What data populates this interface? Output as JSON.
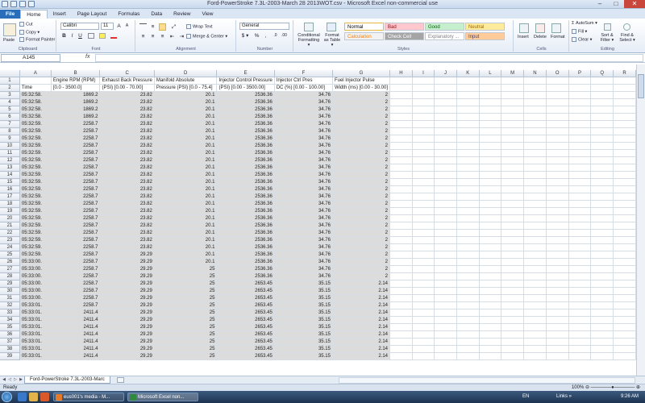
{
  "window": {
    "title": "Ford-PowerStroke 7.3L-2003-March 28 2013WOT.csv - Microsoft Excel non-commercial use",
    "min": "–",
    "max": "□",
    "close": "✕"
  },
  "ribbon_tabs": [
    "File",
    "Home",
    "Insert",
    "Page Layout",
    "Formulas",
    "Data",
    "Review",
    "View"
  ],
  "clipboard": {
    "paste": "Paste",
    "cut": "Cut",
    "copy": "Copy ▾",
    "format_painter": "Format Painter",
    "label": "Clipboard"
  },
  "font": {
    "name": "Calibri",
    "size": "11",
    "grow": "A",
    "shrink": "A",
    "bold": "B",
    "italic": "I",
    "underline": "U",
    "label": "Font"
  },
  "alignment": {
    "wrap": "Wrap Text",
    "merge": "Merge & Center ▾",
    "label": "Alignment"
  },
  "number": {
    "format": "General",
    "currency": "$ ▾",
    "percent": "%",
    "comma": ",",
    "label": "Number"
  },
  "styles": {
    "conditional": "Conditional Formatting ▾",
    "format_table": "Format as Table ▾",
    "cells": [
      {
        "label": "Normal",
        "bg": "#ffffff",
        "fg": "#000000"
      },
      {
        "label": "Bad",
        "bg": "#ffc7ce",
        "fg": "#9c0006"
      },
      {
        "label": "Good",
        "bg": "#c6efce",
        "fg": "#006100"
      },
      {
        "label": "Neutral",
        "bg": "#ffeb9c",
        "fg": "#9c6500"
      },
      {
        "label": "Calculation",
        "bg": "#f2f2f2",
        "fg": "#fa7d00"
      },
      {
        "label": "Check Cell",
        "bg": "#a5a5a5",
        "fg": "#ffffff"
      },
      {
        "label": "Explanatory ...",
        "bg": "#ffffff",
        "fg": "#7f7f7f"
      },
      {
        "label": "Input",
        "bg": "#ffcc99",
        "fg": "#3f3f76"
      }
    ],
    "label": "Styles"
  },
  "cells_group": {
    "insert": "Insert",
    "delete": "Delete",
    "format": "Format",
    "label": "Cells"
  },
  "editing": {
    "autosum": "AutoSum ▾",
    "fill": "Fill ▾",
    "clear": "Clear ▾",
    "sort": "Sort & Filter ▾",
    "find": "Find & Select ▾",
    "label": "Editing"
  },
  "formula_bar": {
    "name_box": "A145",
    "fx": "fx",
    "formula": ""
  },
  "columns": [
    "A",
    "B",
    "C",
    "D",
    "E",
    "F",
    "G",
    "H",
    "I",
    "J",
    "K",
    "L",
    "M",
    "N",
    "O",
    "P",
    "Q",
    "R"
  ],
  "header_row1": [
    "",
    "Engine RPM (RPM)",
    "Exhaust Back Pressure",
    "Manifold Absolute",
    "Injector Control Pressure",
    "Injector Ctrl Pres",
    "Fuel Injector Pulse"
  ],
  "header_row2": [
    "Time",
    "[0.0 - 3500.0]",
    "(PSI) [0.00 - 70.00]",
    "Pressure (PSI) [0.0 - 75.4]",
    "(PSI) [0.00 - 3500.00]",
    "DC (%) [0.00 - 100.00]",
    "Width (ms) [0.00 - 30.00]"
  ],
  "rows": [
    [
      "05:32:58.",
      "1869.2",
      "23.82",
      "20.1",
      "2536.36",
      "34.76",
      "2"
    ],
    [
      "05:32:58.",
      "1869.2",
      "23.82",
      "20.1",
      "2536.36",
      "34.76",
      "2"
    ],
    [
      "05:32:58.",
      "1869.2",
      "23.82",
      "20.1",
      "2536.36",
      "34.76",
      "2"
    ],
    [
      "05:32:58.",
      "1869.2",
      "23.82",
      "20.1",
      "2536.36",
      "34.76",
      "2"
    ],
    [
      "05:32:59.",
      "2258.7",
      "23.82",
      "20.1",
      "2536.36",
      "34.76",
      "2"
    ],
    [
      "05:32:59.",
      "2258.7",
      "23.82",
      "20.1",
      "2536.36",
      "34.76",
      "2"
    ],
    [
      "05:32:59.",
      "2258.7",
      "23.82",
      "20.1",
      "2536.36",
      "34.76",
      "2"
    ],
    [
      "05:32:59.",
      "2258.7",
      "23.82",
      "20.1",
      "2536.36",
      "34.76",
      "2"
    ],
    [
      "05:32:59.",
      "2258.7",
      "23.82",
      "20.1",
      "2536.36",
      "34.76",
      "2"
    ],
    [
      "05:32:59.",
      "2258.7",
      "23.82",
      "20.1",
      "2536.36",
      "34.76",
      "2"
    ],
    [
      "05:32:59.",
      "2258.7",
      "23.82",
      "20.1",
      "2536.36",
      "34.76",
      "2"
    ],
    [
      "05:32:59.",
      "2258.7",
      "23.82",
      "20.1",
      "2536.36",
      "34.76",
      "2"
    ],
    [
      "05:32:59.",
      "2258.7",
      "23.82",
      "20.1",
      "2536.36",
      "34.76",
      "2"
    ],
    [
      "05:32:59.",
      "2258.7",
      "23.82",
      "20.1",
      "2536.36",
      "34.76",
      "2"
    ],
    [
      "05:32:59.",
      "2258.7",
      "23.82",
      "20.1",
      "2536.36",
      "34.76",
      "2"
    ],
    [
      "05:32:59.",
      "2258.7",
      "23.82",
      "20.1",
      "2536.36",
      "34.76",
      "2"
    ],
    [
      "05:32:59.",
      "2258.7",
      "23.82",
      "20.1",
      "2536.36",
      "34.76",
      "2"
    ],
    [
      "05:32:59.",
      "2258.7",
      "23.82",
      "20.1",
      "2536.36",
      "34.76",
      "2"
    ],
    [
      "05:32:59.",
      "2258.7",
      "23.82",
      "20.1",
      "2536.36",
      "34.76",
      "2"
    ],
    [
      "05:32:59.",
      "2258.7",
      "23.82",
      "20.1",
      "2536.36",
      "34.76",
      "2"
    ],
    [
      "05:32:59.",
      "2258.7",
      "23.82",
      "20.1",
      "2536.36",
      "34.76",
      "2"
    ],
    [
      "05:32:59.",
      "2258.7",
      "23.82",
      "20.1",
      "2536.36",
      "34.76",
      "2"
    ],
    [
      "05:32:59.",
      "2258.7",
      "29.29",
      "20.1",
      "2536.36",
      "34.76",
      "2"
    ],
    [
      "05:33:00.",
      "2258.7",
      "29.29",
      "20.1",
      "2536.36",
      "34.76",
      "2"
    ],
    [
      "05:33:00.",
      "2258.7",
      "29.29",
      "25",
      "2536.36",
      "34.76",
      "2"
    ],
    [
      "05:33:00.",
      "2258.7",
      "29.29",
      "25",
      "2536.36",
      "34.76",
      "2"
    ],
    [
      "05:33:00.",
      "2258.7",
      "29.29",
      "25",
      "2653.45",
      "35.15",
      "2.14"
    ],
    [
      "05:33:00.",
      "2258.7",
      "29.29",
      "25",
      "2653.45",
      "35.15",
      "2.14"
    ],
    [
      "05:33:00.",
      "2258.7",
      "29.29",
      "25",
      "2653.45",
      "35.15",
      "2.14"
    ],
    [
      "05:33:01.",
      "2258.7",
      "29.29",
      "25",
      "2653.45",
      "35.15",
      "2.14"
    ],
    [
      "05:33:01.",
      "2411.4",
      "29.29",
      "25",
      "2653.45",
      "35.15",
      "2.14"
    ],
    [
      "05:33:01.",
      "2411.4",
      "29.29",
      "25",
      "2653.45",
      "35.15",
      "2.14"
    ],
    [
      "05:33:01.",
      "2411.4",
      "29.29",
      "25",
      "2653.45",
      "35.15",
      "2.14"
    ],
    [
      "05:33:01.",
      "2411.4",
      "29.29",
      "25",
      "2653.45",
      "35.15",
      "2.14"
    ],
    [
      "05:33:01.",
      "2411.4",
      "29.29",
      "25",
      "2653.45",
      "35.15",
      "2.14"
    ],
    [
      "05:33:01.",
      "2411.4",
      "29.29",
      "25",
      "2653.45",
      "35.15",
      "2.14"
    ],
    [
      "05:33:01.",
      "2411.4",
      "29.29",
      "25",
      "2653.45",
      "35.15",
      "2.14"
    ]
  ],
  "sheet_tab": "Ford-PowerStroke 7.3L-2003-Marc",
  "status": {
    "ready": "Ready",
    "zoom": "100% ⊖ ──────●────── ⊕"
  },
  "taskbar": {
    "buttons": [
      "eus001's media - M...",
      "Microsoft Excel non..."
    ],
    "lang": "EN",
    "links": "Links »",
    "time": "9:26 AM"
  }
}
